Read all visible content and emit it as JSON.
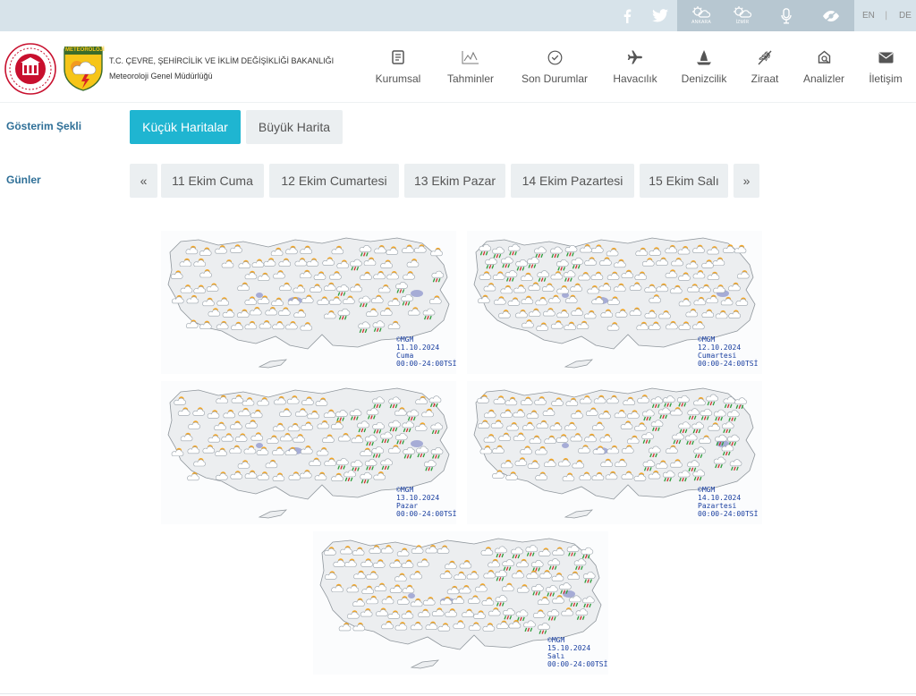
{
  "topbar": {
    "cities": [
      "ANKARA",
      "İZMİR"
    ],
    "lang_en": "EN",
    "lang_sep": "|",
    "lang_de": "DE"
  },
  "header": {
    "org_line1": "T.C. ÇEVRE, ŞEHİRCİLİK VE İKLİM DEĞİŞİKLİĞİ BAKANLIĞI",
    "org_line2": "Meteoroloji Genel Müdürlüğü",
    "logo_text": "METEOROLOJİ",
    "nav": [
      {
        "label": "Kurumsal",
        "icon": "document-icon"
      },
      {
        "label": "Tahminler",
        "icon": "forecast-chart-icon"
      },
      {
        "label": "Son Durumlar",
        "icon": "clock-check-icon"
      },
      {
        "label": "Havacılık",
        "icon": "airplane-icon"
      },
      {
        "label": "Denizcilik",
        "icon": "boat-icon"
      },
      {
        "label": "Ziraat",
        "icon": "wheat-icon"
      },
      {
        "label": "Analizler",
        "icon": "analysis-icon"
      },
      {
        "label": "İletişim",
        "icon": "envelope-icon"
      }
    ]
  },
  "display": {
    "label": "Gösterim Şekli",
    "options": [
      "Küçük Haritalar",
      "Büyük Harita"
    ],
    "selected": "Küçük Haritalar"
  },
  "days": {
    "label": "Günler",
    "prev": "«",
    "next": "»",
    "items": [
      "11 Ekim Cuma",
      "12 Ekim Cumartesi",
      "13 Ekim Pazar",
      "14 Ekim Pazartesi",
      "15 Ekim Salı"
    ]
  },
  "maps": [
    {
      "credit": "©MGM",
      "date": "11.10.2024",
      "day": "Cuma",
      "hours": "00:00-24:00TSİ"
    },
    {
      "credit": "©MGM",
      "date": "12.10.2024",
      "day": "Cumartesi",
      "hours": "00:00-24:00TSİ"
    },
    {
      "credit": "©MGM",
      "date": "13.10.2024",
      "day": "Pazar",
      "hours": "00:00-24:00TSİ"
    },
    {
      "credit": "©MGM",
      "date": "14.10.2024",
      "day": "Pazartesi",
      "hours": "00:00-24:00TSİ"
    },
    {
      "credit": "©MGM",
      "date": "15.10.2024",
      "day": "Salı",
      "hours": "00:00-24:00TSİ"
    }
  ],
  "colors": {
    "accent": "#1fb5d1",
    "label_blue": "#2e6f97",
    "topbar": "#d7e3ea",
    "caption_blue": "#1a3fa0"
  }
}
